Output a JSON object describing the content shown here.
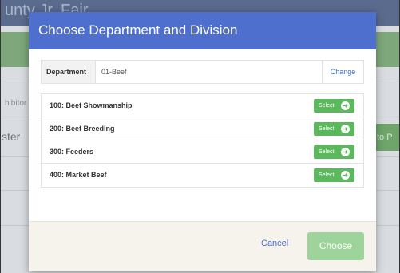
{
  "background": {
    "header_title": "unty Jr. Fair",
    "left_text_1": "hibitor",
    "left_text_2": "ster",
    "right_button": "to P"
  },
  "modal": {
    "title": "Choose Department and Division",
    "department": {
      "label": "Department",
      "value": "01-Beef",
      "change_label": "Change"
    },
    "divisions": [
      {
        "name": "100: Beef Showmanship",
        "button": "Select"
      },
      {
        "name": "200: Beef Breeding",
        "button": "Select"
      },
      {
        "name": "300: Feeders",
        "button": "Select"
      },
      {
        "name": "400: Market Beef",
        "button": "Select"
      }
    ],
    "footer": {
      "cancel_label": "Cancel",
      "choose_label": "Choose"
    }
  },
  "icons": {
    "select_button": "arrow-circle-right-icon"
  },
  "colors": {
    "modal_header": "#4f6fcf",
    "select_button": "#5cb85c",
    "choose_button_disabled": "#9fd39c",
    "link": "#3b6fc4"
  }
}
